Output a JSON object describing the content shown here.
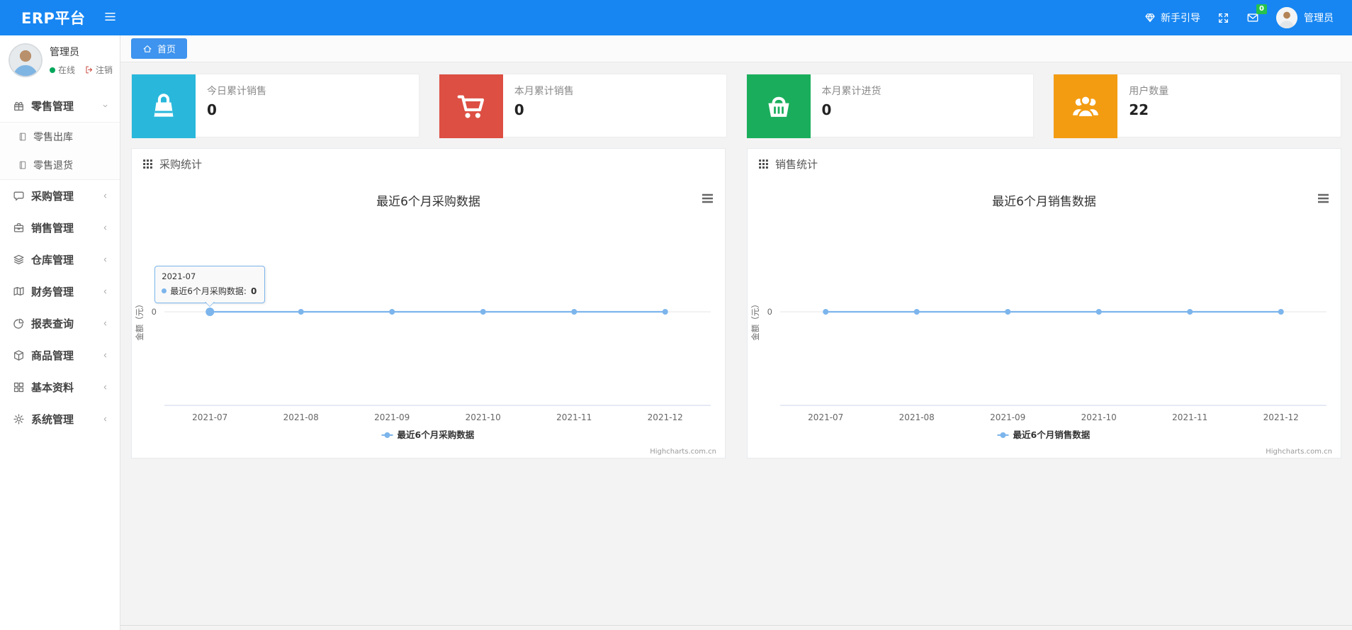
{
  "colors": {
    "navbar": "#1786f2",
    "breadcrumb_tab": "#3e94ee",
    "badge": "#27c24c",
    "online_dot": "#00a65a",
    "series_line": "#7cb5ec",
    "card_cyan": "#29b8db",
    "card_red": "#dd4f43",
    "card_green": "#1aae5c",
    "card_orange": "#f39c12"
  },
  "navbar": {
    "brand": "ERP平台",
    "guide_label": "新手引导",
    "mail_badge": "0",
    "user_name": "管理员"
  },
  "sidebar": {
    "user": {
      "name": "管理员",
      "status": "在线",
      "logout": "注销"
    },
    "menu": [
      {
        "key": "retail-management",
        "label": "零售管理",
        "icon": "gift-icon",
        "expanded": true,
        "children": [
          {
            "key": "retail-outbound",
            "label": "零售出库",
            "icon": "file-icon"
          },
          {
            "key": "retail-return",
            "label": "零售退货",
            "icon": "file-icon"
          }
        ]
      },
      {
        "key": "purchase-management",
        "label": "采购管理",
        "icon": "comment-icon"
      },
      {
        "key": "sales-management",
        "label": "销售管理",
        "icon": "briefcase-icon"
      },
      {
        "key": "warehouse-management",
        "label": "仓库管理",
        "icon": "layers-icon"
      },
      {
        "key": "finance-management",
        "label": "财务管理",
        "icon": "map-icon"
      },
      {
        "key": "report-query",
        "label": "报表查询",
        "icon": "pie-icon"
      },
      {
        "key": "goods-management",
        "label": "商品管理",
        "icon": "cube-icon"
      },
      {
        "key": "basic-data",
        "label": "基本资料",
        "icon": "grid4-icon"
      },
      {
        "key": "system-management",
        "label": "系统管理",
        "icon": "gear-icon"
      }
    ]
  },
  "breadcrumb": {
    "home": "首页"
  },
  "stats": [
    {
      "key": "today-sales",
      "title": "今日累计销售",
      "value": "0",
      "color": "#29b8db",
      "icon": "bag-icon"
    },
    {
      "key": "month-sales",
      "title": "本月累计销售",
      "value": "0",
      "color": "#dd4f43",
      "icon": "cart-icon"
    },
    {
      "key": "month-purchase",
      "title": "本月累计进货",
      "value": "0",
      "color": "#1aae5c",
      "icon": "basket-icon"
    },
    {
      "key": "user-count",
      "title": "用户数量",
      "value": "22",
      "color": "#f39c12",
      "icon": "users-icon"
    }
  ],
  "panels": [
    {
      "key": "purchase-stats",
      "header": "采购统计"
    },
    {
      "key": "sales-stats",
      "header": "销售统计"
    }
  ],
  "chart_data": [
    {
      "type": "line",
      "title": "最近6个月采购数据",
      "categories": [
        "2021-07",
        "2021-08",
        "2021-09",
        "2021-10",
        "2021-11",
        "2021-12"
      ],
      "series": [
        {
          "name": "最近6个月采购数据",
          "values": [
            0,
            0,
            0,
            0,
            0,
            0
          ],
          "color": "#7cb5ec"
        }
      ],
      "xlabel": "",
      "ylabel": "金额（元）",
      "yticks": [
        "0"
      ],
      "ylim": [
        -1,
        1
      ],
      "grid": true,
      "legend_position": "bottom",
      "credits": "Highcharts.com.cn",
      "tooltip": {
        "visible": true,
        "category": "2021-07",
        "series": "最近6个月采购数据",
        "value": "0"
      }
    },
    {
      "type": "line",
      "title": "最近6个月销售数据",
      "categories": [
        "2021-07",
        "2021-08",
        "2021-09",
        "2021-10",
        "2021-11",
        "2021-12"
      ],
      "series": [
        {
          "name": "最近6个月销售数据",
          "values": [
            0,
            0,
            0,
            0,
            0,
            0
          ],
          "color": "#7cb5ec"
        }
      ],
      "xlabel": "",
      "ylabel": "金额（元）",
      "yticks": [
        "0"
      ],
      "ylim": [
        -1,
        1
      ],
      "grid": true,
      "legend_position": "bottom",
      "credits": "Highcharts.com.cn",
      "tooltip": {
        "visible": false
      }
    }
  ]
}
